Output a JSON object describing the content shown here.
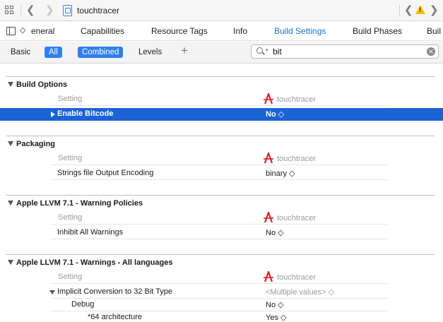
{
  "jumpbar": {
    "file_name": "touchtracer",
    "grid_icon": "grid-icon",
    "back_icon": "chevron-left-icon",
    "forward_icon": "chevron-right-icon",
    "file_icon": "file-icon",
    "issue_back_icon": "chevron-left-icon",
    "warning_icon": "warning-triangle-icon",
    "issue_forward_icon": "chevron-right-icon"
  },
  "tabs": {
    "items": [
      "eneral",
      "Capabilities",
      "Resource Tags",
      "Info",
      "Build Settings",
      "Build Phases",
      "Buil"
    ],
    "active": "Build Settings",
    "sidebar_icon": "sidebar-toggle-icon"
  },
  "filter": {
    "basic": "Basic",
    "all": "All",
    "combined": "Combined",
    "levels": "Levels",
    "add_icon": "plus-icon",
    "search_value": "bit",
    "search_icon": "search-icon",
    "clear_icon": "clear-circle-icon"
  },
  "accent": "#1c63d6",
  "sections": [
    {
      "title": "Build Options",
      "col_setting": "Setting",
      "target": "touchtracer",
      "rows": [
        {
          "label": "Enable Bitcode",
          "value": "No ◇",
          "selected": true
        }
      ]
    },
    {
      "title": "Packaging",
      "col_setting": "Setting",
      "target": "touchtracer",
      "rows": [
        {
          "label": "Strings file Output Encoding",
          "value": "binary ◇"
        }
      ]
    },
    {
      "title": "Apple LLVM 7.1 - Warning Policies",
      "col_setting": "Setting",
      "target": "touchtracer",
      "rows": [
        {
          "label": "Inhibit All Warnings",
          "value": "No ◇"
        }
      ]
    },
    {
      "title": "Apple LLVM 7.1 - Warnings - All languages",
      "col_setting": "Setting",
      "target": "touchtracer",
      "rows": [
        {
          "label": "Implicit Conversion to 32 Bit Type",
          "value": "<Multiple values> ◇"
        },
        {
          "label": "Debug",
          "value": "No ◇"
        },
        {
          "label": "*64 architecture",
          "value": "Yes ◇"
        }
      ]
    }
  ]
}
